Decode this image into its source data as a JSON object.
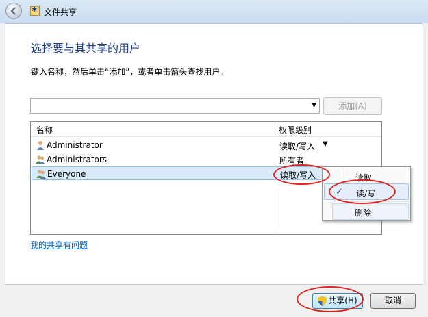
{
  "window": {
    "title": "文件共享"
  },
  "main": {
    "heading": "选择要与其共享的用户",
    "instruction": "键入名称，然后单击“添加”，或者单击箭头查找用户。",
    "add_button": "添加(A)",
    "user_input_value": ""
  },
  "list": {
    "columns": [
      "名称",
      "权限级别"
    ],
    "rows": [
      {
        "name": "Administrator",
        "permission": "读取/写入",
        "icon": "user-icon",
        "has_dropdown": true,
        "selected": false
      },
      {
        "name": "Administrators",
        "permission": "所有者",
        "icon": "group-icon",
        "has_dropdown": false,
        "selected": false
      },
      {
        "name": "Everyone",
        "permission": "读取/写入",
        "icon": "group-icon",
        "has_dropdown": true,
        "selected": true
      }
    ]
  },
  "context_menu": {
    "items": [
      {
        "label": "读取",
        "checked": false
      },
      {
        "label": "读/写",
        "checked": true
      },
      {
        "label": "删除",
        "checked": false
      }
    ]
  },
  "help_link": "我的共享有问题",
  "footer": {
    "share_button": "共享(H)",
    "cancel_button": "取消"
  },
  "colors": {
    "heading": "#1e3f8f",
    "link": "#0066cc",
    "selection": "#d9ebfa",
    "annotation": "#e02020"
  }
}
